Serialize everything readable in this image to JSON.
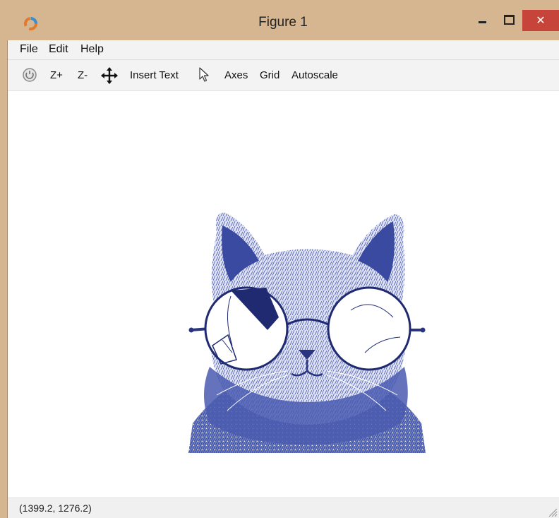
{
  "window": {
    "title": "Figure 1",
    "close_glyph": "✕"
  },
  "menu": {
    "items": [
      "File",
      "Edit",
      "Help"
    ]
  },
  "toolbar": {
    "zoom_in": "Z+",
    "zoom_out": "Z-",
    "insert_text": "Insert Text",
    "axes": "Axes",
    "grid": "Grid",
    "autoscale": "Autoscale",
    "icons": [
      "rotate-icon",
      "pan-icon",
      "select-pointer-icon"
    ]
  },
  "figure": {
    "image_subject": "cat with round glasses, blue monochrome",
    "tint_color": "#3a4aa0"
  },
  "status": {
    "coordinates": "(1399.2, 1276.2)"
  },
  "colors": {
    "titlebar": "#d6b591",
    "close_button": "#c7443a",
    "menubar": "#f3f3f3"
  }
}
